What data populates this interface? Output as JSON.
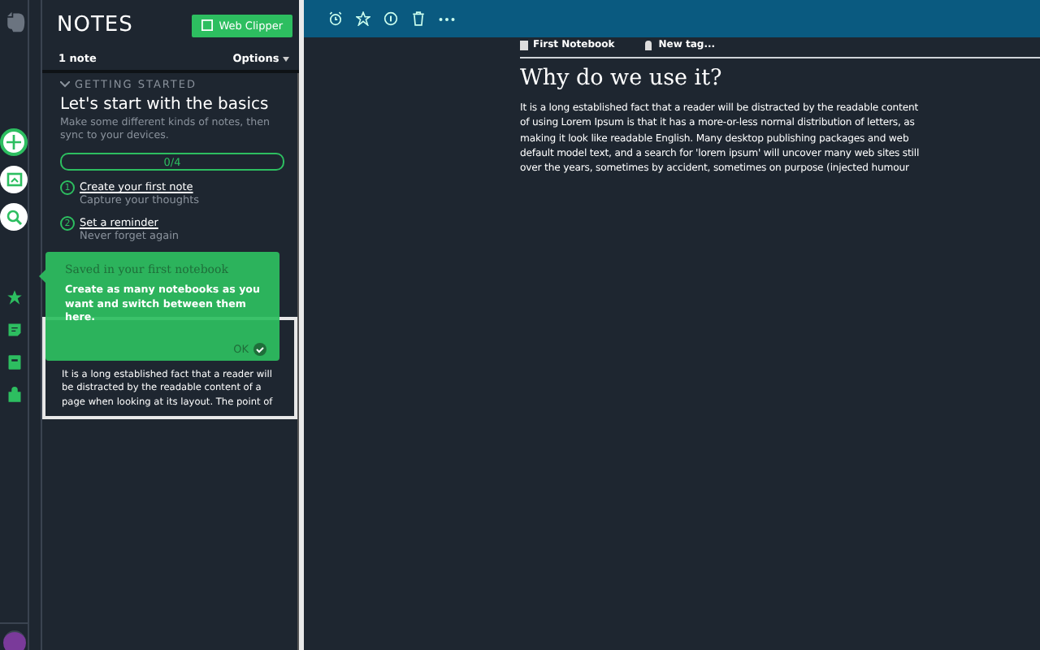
{
  "notes_panel": {
    "title": "NOTES",
    "web_clipper": "Web Clipper",
    "count": "1 note",
    "options": "Options",
    "getting_started": {
      "section": "GETTING STARTED",
      "expanded": true,
      "title": "Let's start with the basics",
      "description": "Make some different kinds of notes, then sync to your devices.",
      "progress": {
        "level": 0,
        "reading": "0/4"
      },
      "steps": [
        {
          "number": "1",
          "title": "Create your first note",
          "subtitle": "Capture your thoughts"
        },
        {
          "number": "2",
          "title": "Set a reminder",
          "subtitle": "Never forget again"
        }
      ]
    },
    "notes": [
      {
        "snippet": "It is a long established fact that a reader will be distracted by the readable content of a page when looking at its layout. The point of",
        "selected": true
      }
    ]
  },
  "tooltip": {
    "title": "Saved in your first notebook",
    "body": "Create as many notebooks as you want and switch between them here.",
    "ok": "OK"
  },
  "editor": {
    "notebook": "First Notebook",
    "tag": "New tag...",
    "title": "Why do we use it?",
    "body_lines": [
      "It is a long established fact that a reader will be distracted by the readable content",
      "of using Lorem Ipsum is that it has a more-or-less normal distribution of letters, as",
      "making it look like readable English. Many desktop publishing packages and web",
      "default model text, and a search for 'lorem ipsum' will uncover many web sites still",
      "over the years, sometimes by accident, sometimes on purpose (injected humour"
    ]
  }
}
